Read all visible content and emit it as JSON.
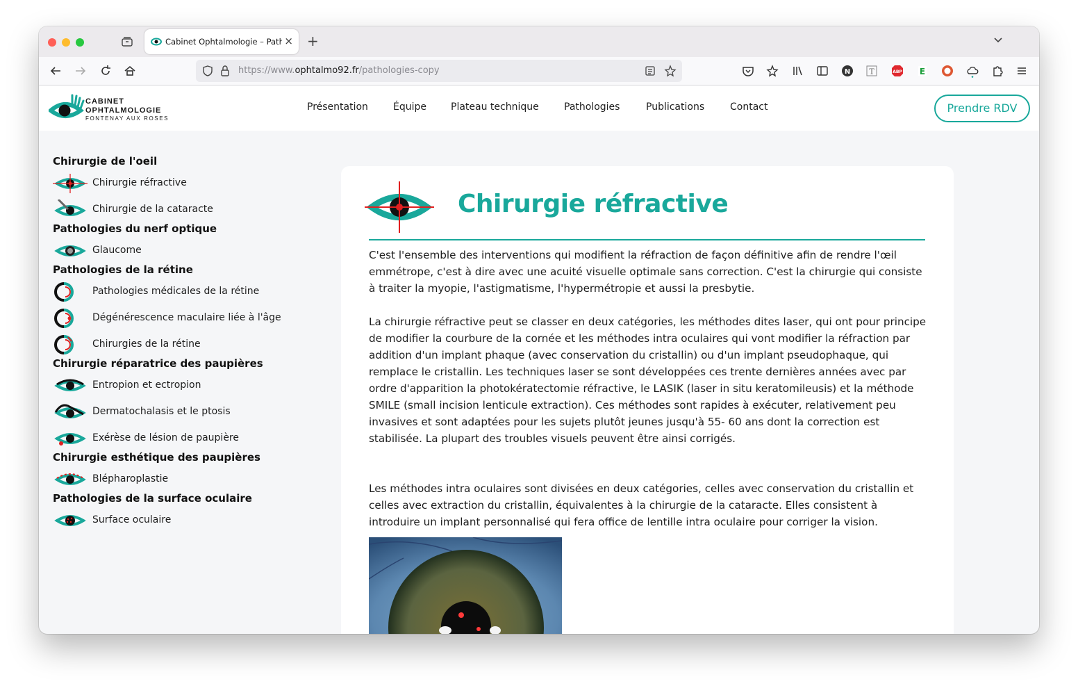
{
  "browser": {
    "tab_title": "Cabinet Ophtalmologie – Pathol",
    "url_prefix": "https://www.",
    "url_host": "ophtalmo92.fr",
    "url_path": "/pathologies-copy"
  },
  "logo": {
    "line1": "CABINET",
    "line2": "OPHTALMOLOGIE",
    "line3": "FONTENAY AUX ROSES"
  },
  "nav": {
    "items": [
      "Présentation",
      "Équipe",
      "Plateau technique",
      "Pathologies",
      "Publications",
      "Contact"
    ],
    "cta": "Prendre RDV"
  },
  "sidebar": {
    "categories": [
      "Chirurgie de l'oeil",
      "Pathologies du nerf optique",
      "Pathologies de la rétine",
      "Chirurgie réparatrice des paupières",
      "Chirurgie esthétique des paupières",
      "Pathologies de la surface oculaire"
    ],
    "items": [
      "Chirurgie réfractive",
      "Chirurgie de la cataracte",
      "Glaucome",
      "Pathologies médicales de la rétine",
      "Dégénérescence maculaire liée à l'âge",
      "Chirurgies de la rétine",
      "Entropion et ectropion",
      "Dermatochalasis et le ptosis",
      "Exérèse de lésion de paupière",
      "Blépharoplastie",
      "Surface oculaire"
    ]
  },
  "article": {
    "title": "Chirurgie réfractive",
    "paragraphs": [
      "C'est l'ensemble des interventions qui modifient la réfraction de façon définitive afin de rendre l'œil emmétrope, c'est à dire avec une acuité visuelle optimale sans correction. C'est la chirurgie qui consiste à traiter la myopie, l'astigmatisme, l'hypermétropie et aussi la presbytie.",
      "La chirurgie réfractive peut se classer en deux catégories, les méthodes dites laser, qui ont pour principe de modifier la courbure de la cornée et les méthodes intra oculaires qui vont modifier la réfraction par addition d'un implant phaque (avec conservation du cristallin) ou d'un implant pseudophaque, qui remplace le cristallin. Les techniques laser se sont développées ces trente dernières années avec par ordre d'apparition la photokératectomie réfractive, le LASIK (laser in situ keratomileusis) et la méthode SMILE (small incision lenticule extraction). Ces méthodes sont rapides à exécuter, relativement peu invasives et sont adaptées pour les sujets plutôt jeunes jusqu'à 55- 60 ans dont la correction est stabilisée. La plupart des troubles visuels peuvent être ainsi corrigés.",
      "Les méthodes intra oculaires sont divisées en deux catégories, celles avec conservation du cristallin et celles avec extraction du cristallin, équivalentes à la chirurgie de la cataracte. Elles consistent à introduire un implant personnalisé qui fera office de lentille intra oculaire pour corriger la vision."
    ]
  },
  "colors": {
    "brand_teal": "#19a89b",
    "accent_red": "#e02020",
    "text_dark": "#1e1e1e"
  }
}
